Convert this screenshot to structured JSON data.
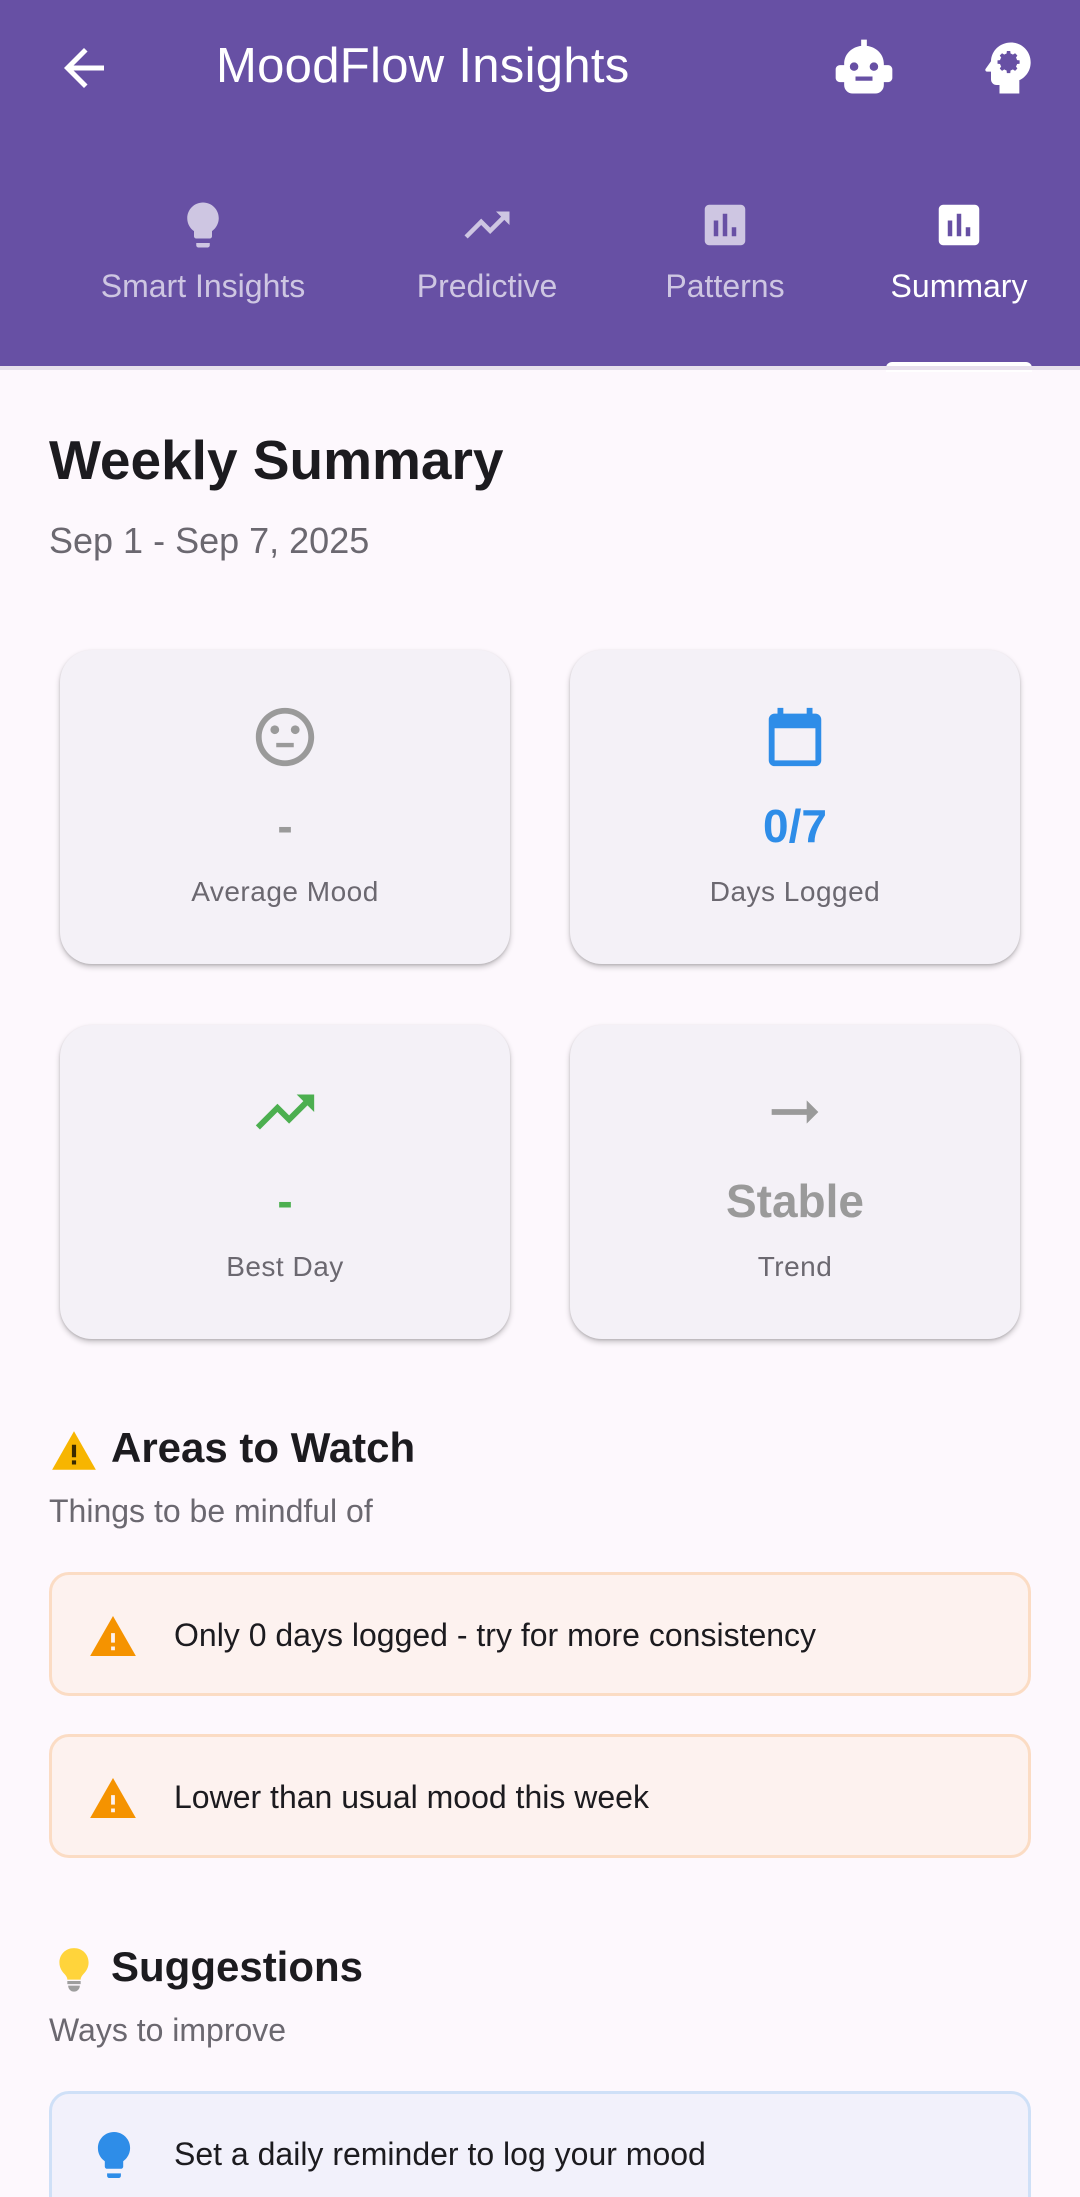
{
  "appbar": {
    "title": "MoodFlow Insights",
    "back_icon": "arrow-back-icon",
    "actions": [
      {
        "icon": "robot-icon"
      },
      {
        "icon": "psychology-head-gear-icon"
      }
    ],
    "background": "#6750a4"
  },
  "tabs": [
    {
      "label": "Smart Insights",
      "icon": "lightbulb-icon",
      "active": false
    },
    {
      "label": "Predictive",
      "icon": "trending-up-icon",
      "active": false
    },
    {
      "label": "Patterns",
      "icon": "bar-chart-icon",
      "active": false
    },
    {
      "label": "Summary",
      "icon": "bar-chart-icon",
      "active": true
    }
  ],
  "summary": {
    "title": "Weekly Summary",
    "date_range": "Sep 1 - Sep 7, 2025"
  },
  "stats": [
    {
      "icon": "neutral-face-icon",
      "value": "-",
      "label": "Average Mood",
      "color": "#9a9a9a"
    },
    {
      "icon": "calendar-icon",
      "value": "0/7",
      "label": "Days Logged",
      "color": "#2e8de8"
    },
    {
      "icon": "trending-up-icon",
      "value": "-",
      "label": "Best Day",
      "color": "#4caf50"
    },
    {
      "icon": "arrow-right-icon",
      "value": "Stable",
      "label": "Trend",
      "color": "#9a9a9a"
    }
  ],
  "areas": {
    "emoji": "warning-emoji",
    "title": "Areas to Watch",
    "subtitle": "Things to be mindful of",
    "items": [
      {
        "icon": "warning-icon",
        "text": "Only 0 days logged - try for more consistency"
      },
      {
        "icon": "warning-icon",
        "text": "Lower than usual mood this week"
      }
    ],
    "accent": "#f59300"
  },
  "suggestions": {
    "emoji": "lightbulb-emoji",
    "title": "Suggestions",
    "subtitle": "Ways to improve",
    "items": [
      {
        "icon": "lightbulb-icon",
        "text": "Set a daily reminder to log your mood"
      }
    ],
    "accent": "#2e8de8"
  }
}
